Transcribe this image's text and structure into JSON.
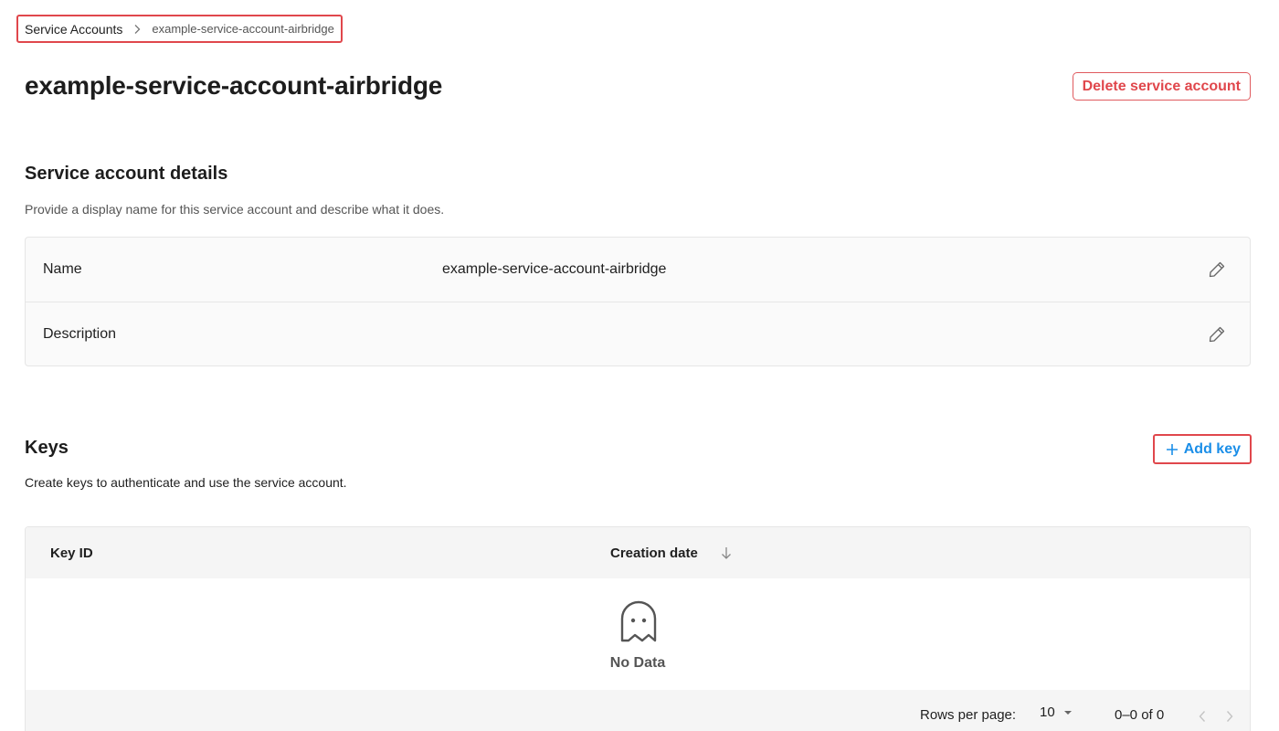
{
  "breadcrumb": {
    "root": "Service Accounts",
    "current": "example-service-account-airbridge"
  },
  "header": {
    "title": "example-service-account-airbridge",
    "delete_label": "Delete service account"
  },
  "details": {
    "title": "Service account details",
    "description": "Provide a display name for this service account and describe what it does.",
    "rows": [
      {
        "label": "Name",
        "value": "example-service-account-airbridge"
      },
      {
        "label": "Description",
        "value": ""
      }
    ]
  },
  "keys": {
    "title": "Keys",
    "description": "Create keys to authenticate and use the service account.",
    "add_label": "Add key",
    "columns": [
      "Key ID",
      "Creation date"
    ],
    "empty_text": "No Data",
    "footer": {
      "rows_per_page_label": "Rows per page:",
      "rows_per_page": "10",
      "range": "0–0 of 0"
    }
  },
  "colors": {
    "accent_red": "#e0474c",
    "accent_blue": "#1a8ee8"
  }
}
